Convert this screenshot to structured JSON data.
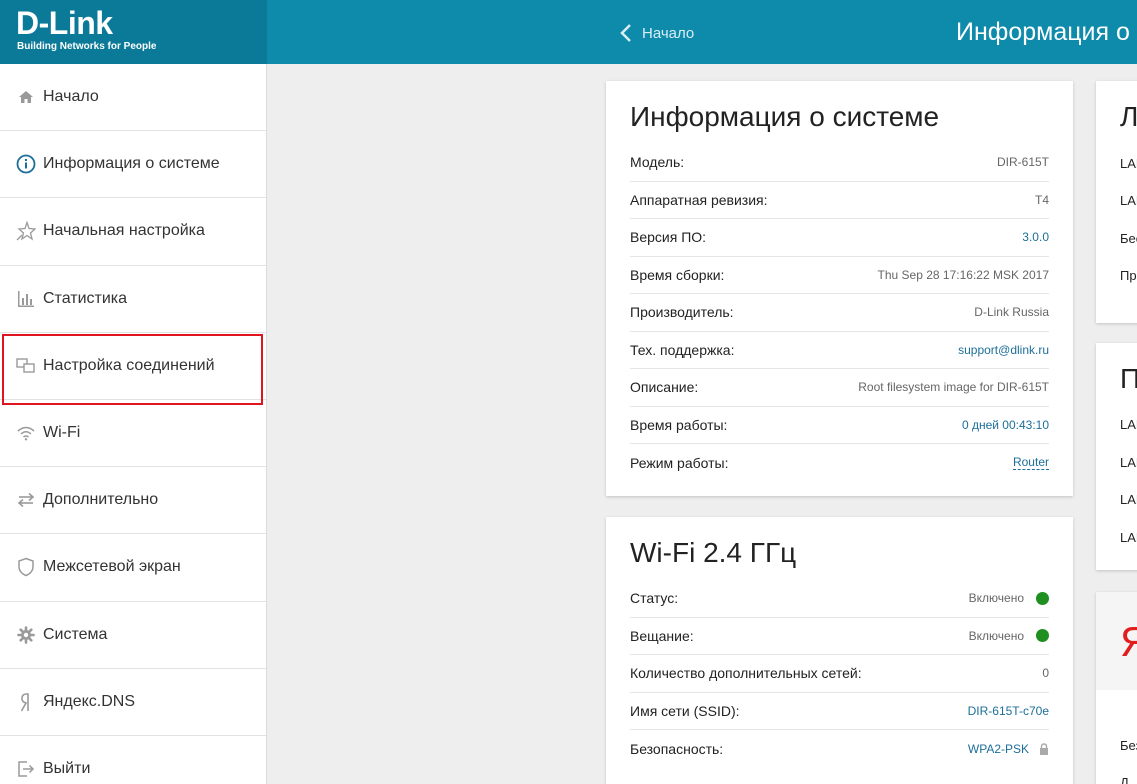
{
  "header": {
    "logo_main": "D-Link",
    "logo_tagline": "Building Networks for People",
    "back_label": "Начало",
    "title": "Информация о с"
  },
  "sidebar": {
    "items": [
      {
        "label": "Начало",
        "icon": "home-icon"
      },
      {
        "label": "Информация о системе",
        "icon": "info-icon"
      },
      {
        "label": "Начальная настройка",
        "icon": "star-icon"
      },
      {
        "label": "Статистика",
        "icon": "bar-chart-icon"
      },
      {
        "label": "Настройка соединений",
        "icon": "connections-icon"
      },
      {
        "label": "Wi-Fi",
        "icon": "wifi-icon"
      },
      {
        "label": "Дополнительно",
        "icon": "arrows-icon"
      },
      {
        "label": "Межсетевой экран",
        "icon": "shield-icon"
      },
      {
        "label": "Система",
        "icon": "gear-icon"
      },
      {
        "label": "Яндекс.DNS",
        "icon": "yandex-icon"
      },
      {
        "label": "Выйти",
        "icon": "logout-icon"
      }
    ]
  },
  "system_info": {
    "title": "Информация о системе",
    "rows": [
      {
        "key": "Модель:",
        "value": "DIR-615T"
      },
      {
        "key": "Аппаратная ревизия:",
        "value": "T4"
      },
      {
        "key": "Версия ПО:",
        "value": "3.0.0"
      },
      {
        "key": "Время сборки:",
        "value": "Thu Sep 28 17:16:22 MSK 2017"
      },
      {
        "key": "Производитель:",
        "value": "D-Link Russia"
      },
      {
        "key": "Тех. поддержка:",
        "value": "support@dlink.ru"
      },
      {
        "key": "Описание:",
        "value": "Root filesystem image for DIR-615T"
      },
      {
        "key": "Время работы:",
        "value": "0 дней 00:43:10"
      },
      {
        "key": "Режим работы:",
        "value": "Router"
      }
    ]
  },
  "wifi": {
    "title": "Wi-Fi 2.4 ГГц",
    "rows": [
      {
        "key": "Статус:",
        "value": "Включено"
      },
      {
        "key": "Вещание:",
        "value": "Включено"
      },
      {
        "key": "Количество дополнительных сетей:",
        "value": "0"
      },
      {
        "key": "Имя сети (SSID):",
        "value": "DIR-615T-c70e"
      },
      {
        "key": "Безопасность:",
        "value": "WPA2-PSK"
      }
    ]
  },
  "right_panels": {
    "panel1_title": "Л",
    "panel1_rows": [
      "LAN",
      "LAN",
      "Бес",
      "Пр"
    ],
    "panel2_title": "П",
    "panel2_rows": [
      "LAN",
      "LAN",
      "LAN",
      "LAN"
    ],
    "panel3_title": "Я",
    "panel3_rows": [
      "Без",
      "Д"
    ]
  },
  "colors": {
    "header": "#0e8aab",
    "accent_link": "#1d6f99",
    "status_on": "#1f8f1f",
    "highlight": "#e0141e"
  }
}
